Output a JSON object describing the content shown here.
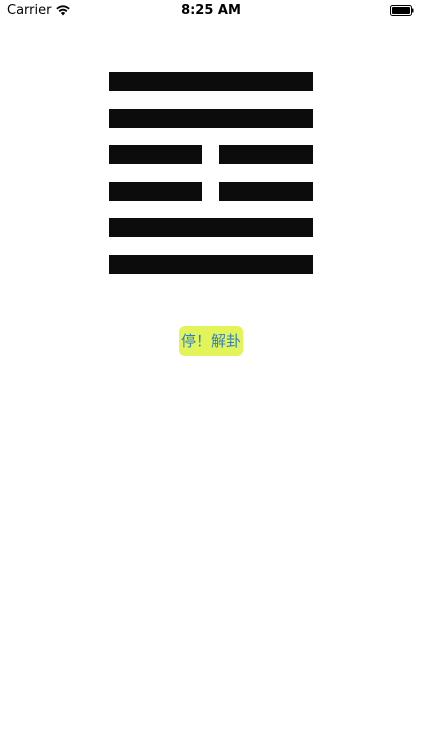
{
  "status_bar": {
    "carrier": "Carrier",
    "time": "8:25 AM",
    "wifi_icon": "wifi-icon",
    "battery_icon": "battery-icon"
  },
  "hexagram": {
    "lines_top_to_bottom": [
      "yang",
      "yang",
      "yin",
      "yin",
      "yang",
      "yang"
    ],
    "line_color": "#0c0c0c"
  },
  "action_button": {
    "label": "停！解卦",
    "background": "#e2f45a",
    "text_color": "#2f7fc4"
  }
}
